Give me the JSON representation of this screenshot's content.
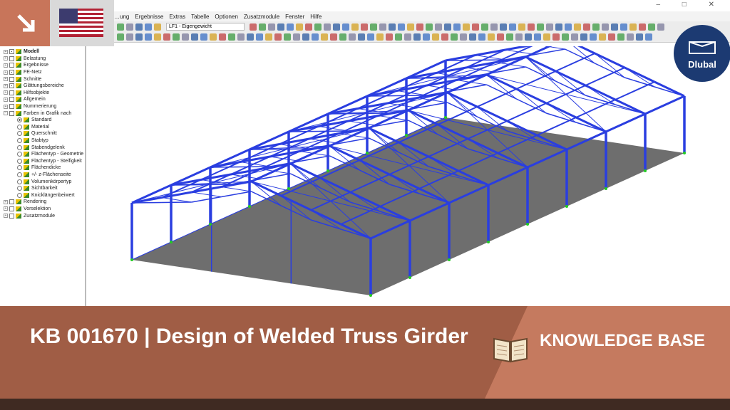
{
  "window": {
    "controls": "– □ ✕"
  },
  "menu": [
    "…ung",
    "Ergebnisse",
    "Extras",
    "Tabelle",
    "Optionen",
    "Zusatzmodule",
    "Fenster",
    "Hilfe"
  ],
  "toolbar": {
    "loadcase": "LF1 - Eigengewicht"
  },
  "tree": [
    {
      "label": "Modell",
      "type": "cb",
      "checked": true,
      "bold": true,
      "lvl": 0
    },
    {
      "label": "Belastung",
      "type": "cb",
      "lvl": 0
    },
    {
      "label": "Ergebnisse",
      "type": "cb",
      "lvl": 0
    },
    {
      "label": "FE-Netz",
      "type": "cb",
      "checked": true,
      "lvl": 0
    },
    {
      "label": "Schnitte",
      "type": "cb",
      "lvl": 0
    },
    {
      "label": "Glättungsbereiche",
      "type": "cb",
      "checked": true,
      "lvl": 0
    },
    {
      "label": "Hilfsobjekte",
      "type": "cb",
      "lvl": 0
    },
    {
      "label": "Allgemein",
      "type": "cb",
      "lvl": 0
    },
    {
      "label": "Nummerierung",
      "type": "cb",
      "lvl": 0
    },
    {
      "label": "Farben in Grafik nach",
      "type": "cb",
      "lvl": 0,
      "open": true
    },
    {
      "label": "Standard",
      "type": "rd",
      "checked": true,
      "lvl": 1
    },
    {
      "label": "Material",
      "type": "rd",
      "lvl": 1
    },
    {
      "label": "Querschnitt",
      "type": "rd",
      "lvl": 1
    },
    {
      "label": "Stabtyp",
      "type": "rd",
      "lvl": 1
    },
    {
      "label": "Stabendgelenk",
      "type": "rd",
      "lvl": 1
    },
    {
      "label": "Flächentyp - Geometrie",
      "type": "rd",
      "lvl": 1
    },
    {
      "label": "Flächentyp - Steifigkeit",
      "type": "rd",
      "lvl": 1
    },
    {
      "label": "Flächendicke",
      "type": "rd",
      "lvl": 1
    },
    {
      "label": "+/- z-Flächenseite",
      "type": "rd",
      "lvl": 1
    },
    {
      "label": "Volumenkörpertyp",
      "type": "rd",
      "lvl": 1
    },
    {
      "label": "Sichtbarkeit",
      "type": "rd",
      "lvl": 1
    },
    {
      "label": "Knicklängenbeiwert",
      "type": "rd",
      "lvl": 1
    },
    {
      "label": "Rendering",
      "type": "cb",
      "lvl": 0
    },
    {
      "label": "Vorselektion",
      "type": "cb",
      "lvl": 0
    },
    {
      "label": "Zusatzmodule",
      "type": "cb",
      "lvl": 0
    }
  ],
  "logo": "Dlubal",
  "banner": {
    "title": "KB 001670 | Design of Welded Truss Girder",
    "category": "KNOWLEDGE BASE"
  },
  "colors": {
    "accent": "#c8755a",
    "banner": "#a05d45",
    "member": "#2a3ee0"
  }
}
